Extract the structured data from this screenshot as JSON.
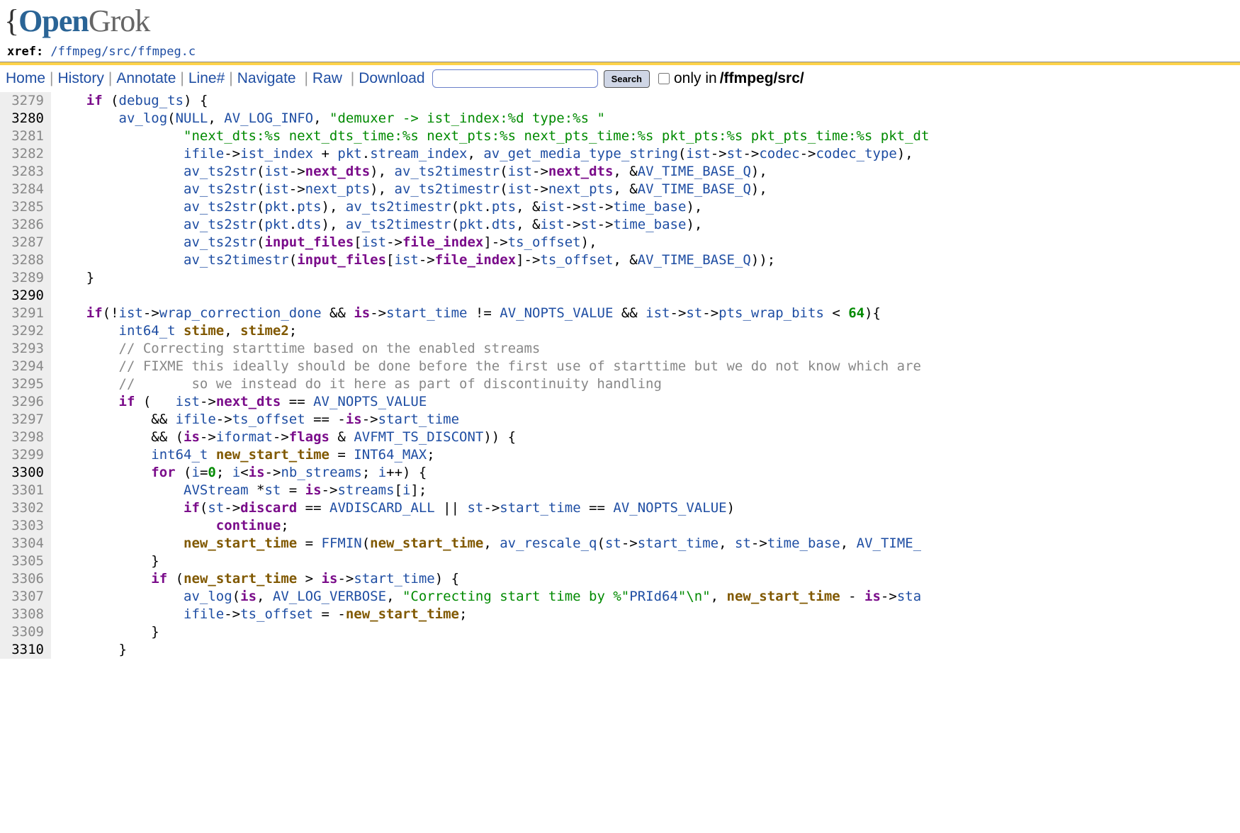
{
  "header": {
    "logo_prefix": "{",
    "logo_open": "Open",
    "logo_grok": "Grok",
    "xref_label": "xref: ",
    "path_seg_1": "/ffmpeg",
    "path_seg_2": "/src",
    "path_seg_3": "/ffmpeg.c"
  },
  "toolbar": {
    "home": "Home",
    "history": "History",
    "annotate": "Annotate",
    "line": "Line#",
    "navigate": "Navigate",
    "raw": "Raw",
    "download": "Download",
    "search_placeholder": "",
    "search_btn": "Search",
    "only_in_txt": "only in ",
    "only_in_path": "/ffmpeg/src/"
  },
  "code": {
    "lines": [
      {
        "n": "3279",
        "bold": false
      },
      {
        "n": "3280",
        "bold": true
      },
      {
        "n": "3281",
        "bold": false
      },
      {
        "n": "3282",
        "bold": false
      },
      {
        "n": "3283",
        "bold": false
      },
      {
        "n": "3284",
        "bold": false
      },
      {
        "n": "3285",
        "bold": false
      },
      {
        "n": "3286",
        "bold": false
      },
      {
        "n": "3287",
        "bold": false
      },
      {
        "n": "3288",
        "bold": false
      },
      {
        "n": "3289",
        "bold": false
      },
      {
        "n": "3290",
        "bold": true
      },
      {
        "n": "3291",
        "bold": false
      },
      {
        "n": "3292",
        "bold": false
      },
      {
        "n": "3293",
        "bold": false
      },
      {
        "n": "3294",
        "bold": false
      },
      {
        "n": "3295",
        "bold": false
      },
      {
        "n": "3296",
        "bold": false
      },
      {
        "n": "3297",
        "bold": false
      },
      {
        "n": "3298",
        "bold": false
      },
      {
        "n": "3299",
        "bold": false
      },
      {
        "n": "3300",
        "bold": true
      },
      {
        "n": "3301",
        "bold": false
      },
      {
        "n": "3302",
        "bold": false
      },
      {
        "n": "3303",
        "bold": false
      },
      {
        "n": "3304",
        "bold": false
      },
      {
        "n": "3305",
        "bold": false
      },
      {
        "n": "3306",
        "bold": false
      },
      {
        "n": "3307",
        "bold": false
      },
      {
        "n": "3308",
        "bold": false
      },
      {
        "n": "3309",
        "bold": false
      },
      {
        "n": "3310",
        "bold": true
      }
    ],
    "src": [
      "    <span class='kw'>if</span> (<span class='id'>debug_ts</span>) {",
      "        <span class='fn'>av_log</span>(<span class='id'>NULL</span>, <span class='id'>AV_LOG_INFO</span>, <span class='st'>\"demuxer -&gt; ist_index:%d type:%s \"</span>",
      "                <span class='st'>\"next_dts:%s next_dts_time:%s next_pts:%s next_pts_time:%s pkt_pts:%s pkt_pts_time:%s pkt_dt</span>",
      "                <span class='id'>ifile</span>-&gt;<span class='id'>ist_index</span> + <span class='id'>pkt</span>.<span class='id'>stream_index</span>, <span class='fn'>av_get_media_type_string</span>(<span class='id'>ist</span>-&gt;<span class='id'>st</span>-&gt;<span class='id'>codec</span>-&gt;<span class='id'>codec_type</span>),",
      "                <span class='fn'>av_ts2str</span>(<span class='id'>ist</span>-&gt;<span class='fi'>next_dts</span>), <span class='fn'>av_ts2timestr</span>(<span class='id'>ist</span>-&gt;<span class='fi'>next_dts</span>, &amp;<span class='id'>AV_TIME_BASE_Q</span>),",
      "                <span class='fn'>av_ts2str</span>(<span class='id'>ist</span>-&gt;<span class='id'>next_pts</span>), <span class='fn'>av_ts2timestr</span>(<span class='id'>ist</span>-&gt;<span class='id'>next_pts</span>, &amp;<span class='id'>AV_TIME_BASE_Q</span>),",
      "                <span class='fn'>av_ts2str</span>(<span class='id'>pkt</span>.<span class='id'>pts</span>), <span class='fn'>av_ts2timestr</span>(<span class='id'>pkt</span>.<span class='id'>pts</span>, &amp;<span class='id'>ist</span>-&gt;<span class='id'>st</span>-&gt;<span class='id'>time_base</span>),",
      "                <span class='fn'>av_ts2str</span>(<span class='id'>pkt</span>.<span class='id'>dts</span>), <span class='fn'>av_ts2timestr</span>(<span class='id'>pkt</span>.<span class='id'>dts</span>, &amp;<span class='id'>ist</span>-&gt;<span class='id'>st</span>-&gt;<span class='id'>time_base</span>),",
      "                <span class='fn'>av_ts2str</span>(<span class='fi'>input_files</span>[<span class='id'>ist</span>-&gt;<span class='fi'>file_index</span>]-&gt;<span class='id'>ts_offset</span>),",
      "                <span class='fn'>av_ts2timestr</span>(<span class='fi'>input_files</span>[<span class='id'>ist</span>-&gt;<span class='fi'>file_index</span>]-&gt;<span class='id'>ts_offset</span>, &amp;<span class='id'>AV_TIME_BASE_Q</span>));",
      "    }",
      "",
      "    <span class='kw'>if</span>(!<span class='id'>ist</span>-&gt;<span class='id'>wrap_correction_done</span> &amp;&amp; <span class='fi'>is</span>-&gt;<span class='id'>start_time</span> != <span class='id'>AV_NOPTS_VALUE</span> &amp;&amp; <span class='id'>ist</span>-&gt;<span class='id'>st</span>-&gt;<span class='id'>pts_wrap_bits</span> &lt; <span class='nm'>64</span>){",
      "        <span class='ty'>int64_t</span> <span class='vr'>stime</span>, <span class='vr'>stime2</span>;",
      "        <span class='cm'>// Correcting starttime based on the enabled streams</span>",
      "        <span class='cm'>// FIXME this ideally should be done before the first use of starttime but we do not know which are</span>",
      "        <span class='cm'>//       so we instead do it here as part of discontinuity handling</span>",
      "        <span class='kw'>if</span> (   <span class='id'>ist</span>-&gt;<span class='fi'>next_dts</span> == <span class='id'>AV_NOPTS_VALUE</span>",
      "            &amp;&amp; <span class='id'>ifile</span>-&gt;<span class='id'>ts_offset</span> == -<span class='fi'>is</span>-&gt;<span class='id'>start_time</span>",
      "            &amp;&amp; (<span class='fi'>is</span>-&gt;<span class='id'>iformat</span>-&gt;<span class='fi'>flags</span> &amp; <span class='id'>AVFMT_TS_DISCONT</span>)) {",
      "            <span class='ty'>int64_t</span> <span class='vr'>new_start_time</span> = <span class='id'>INT64_MAX</span>;",
      "            <span class='kw'>for</span> (<span class='id'>i</span>=<span class='nm'>0</span>; <span class='id'>i</span>&lt;<span class='fi'>is</span>-&gt;<span class='id'>nb_streams</span>; <span class='id'>i</span>++) {",
      "                <span class='id'>AVStream</span> *<span class='id'>st</span> = <span class='fi'>is</span>-&gt;<span class='id'>streams</span>[<span class='id'>i</span>];",
      "                <span class='kw'>if</span>(<span class='id'>st</span>-&gt;<span class='fi'>discard</span> == <span class='id'>AVDISCARD_ALL</span> || <span class='id'>st</span>-&gt;<span class='id'>start_time</span> == <span class='id'>AV_NOPTS_VALUE</span>)",
      "                    <span class='kw'>continue</span>;",
      "                <span class='vr'>new_start_time</span> = <span class='id'>FFMIN</span>(<span class='vr'>new_start_time</span>, <span class='fn'>av_rescale_q</span>(<span class='id'>st</span>-&gt;<span class='id'>start_time</span>, <span class='id'>st</span>-&gt;<span class='id'>time_base</span>, <span class='id'>AV_TIME_</span>",
      "            }",
      "            <span class='kw'>if</span> (<span class='vr'>new_start_time</span> &gt; <span class='fi'>is</span>-&gt;<span class='id'>start_time</span>) {",
      "                <span class='fn'>av_log</span>(<span class='fi'>is</span>, <span class='id'>AV_LOG_VERBOSE</span>, <span class='st'>\"Correcting start time by %\"</span><span class='id'>PRId64</span><span class='st'>\"\\n\"</span>, <span class='vr'>new_start_time</span> - <span class='fi'>is</span>-&gt;<span class='id'>sta</span>",
      "                <span class='id'>ifile</span>-&gt;<span class='id'>ts_offset</span> = -<span class='vr'>new_start_time</span>;",
      "            }",
      "        }"
    ]
  }
}
